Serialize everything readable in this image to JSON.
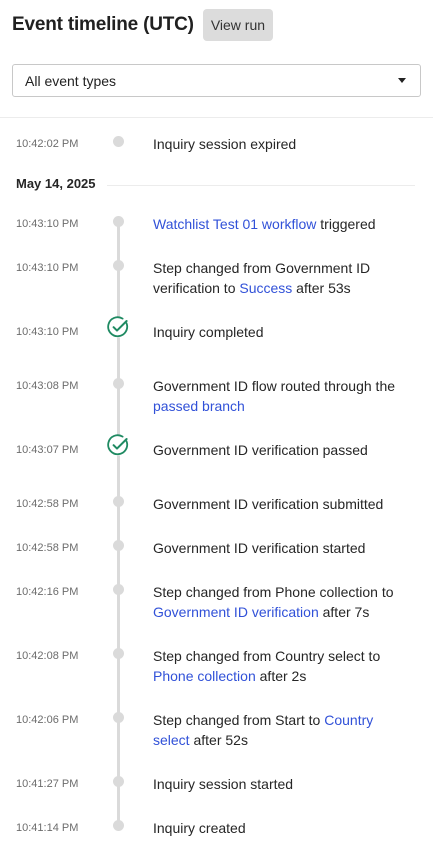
{
  "header": {
    "title": "Event timeline (UTC)",
    "view_run_label": "View run"
  },
  "filter": {
    "selected": "All event types"
  },
  "prior_event": {
    "time": "10:42:02 PM",
    "text": "Inquiry session expired"
  },
  "date_group": {
    "label": "May 14, 2025"
  },
  "events": [
    {
      "time": "10:43:10 PM",
      "parts": [
        {
          "t": "Watchlist Test 01 workflow",
          "link": true
        },
        {
          "t": " triggered"
        }
      ],
      "marker": "dot"
    },
    {
      "time": "10:43:10 PM",
      "parts": [
        {
          "t": "Step changed from Government ID verification to "
        },
        {
          "t": "Success",
          "link": true
        },
        {
          "t": " after 53s"
        }
      ],
      "marker": "dot"
    },
    {
      "time": "10:43:10 PM",
      "parts": [
        {
          "t": "Inquiry completed"
        }
      ],
      "marker": "check"
    },
    {
      "time": "10:43:08 PM",
      "parts": [
        {
          "t": "Government ID flow routed through the "
        },
        {
          "t": "passed branch",
          "link": true
        }
      ],
      "marker": "dot"
    },
    {
      "time": "10:43:07 PM",
      "parts": [
        {
          "t": "Government ID verification passed"
        }
      ],
      "marker": "check"
    },
    {
      "time": "10:42:58 PM",
      "parts": [
        {
          "t": "Government ID verification submitted"
        }
      ],
      "marker": "dot"
    },
    {
      "time": "10:42:58 PM",
      "parts": [
        {
          "t": "Government ID verification started"
        }
      ],
      "marker": "dot"
    },
    {
      "time": "10:42:16 PM",
      "parts": [
        {
          "t": "Step changed from Phone collection to "
        },
        {
          "t": "Government ID verification",
          "link": true
        },
        {
          "t": " after 7s"
        }
      ],
      "marker": "dot"
    },
    {
      "time": "10:42:08 PM",
      "parts": [
        {
          "t": "Step changed from Country select to "
        },
        {
          "t": "Phone collection",
          "link": true
        },
        {
          "t": " after 2s"
        }
      ],
      "marker": "dot"
    },
    {
      "time": "10:42:06 PM",
      "parts": [
        {
          "t": "Step changed from Start to "
        },
        {
          "t": "Country select",
          "link": true
        },
        {
          "t": " after 52s"
        }
      ],
      "marker": "dot"
    },
    {
      "time": "10:41:27 PM",
      "parts": [
        {
          "t": "Inquiry session started"
        }
      ],
      "marker": "dot"
    },
    {
      "time": "10:41:14 PM",
      "parts": [
        {
          "t": "Inquiry created"
        }
      ],
      "marker": "dot"
    }
  ],
  "colors": {
    "link": "#3151d8",
    "success_check": "#1f8a62",
    "timeline": "#dadada"
  },
  "icons": {
    "dropdown": "caret-down-icon",
    "success": "check-circle-icon"
  }
}
